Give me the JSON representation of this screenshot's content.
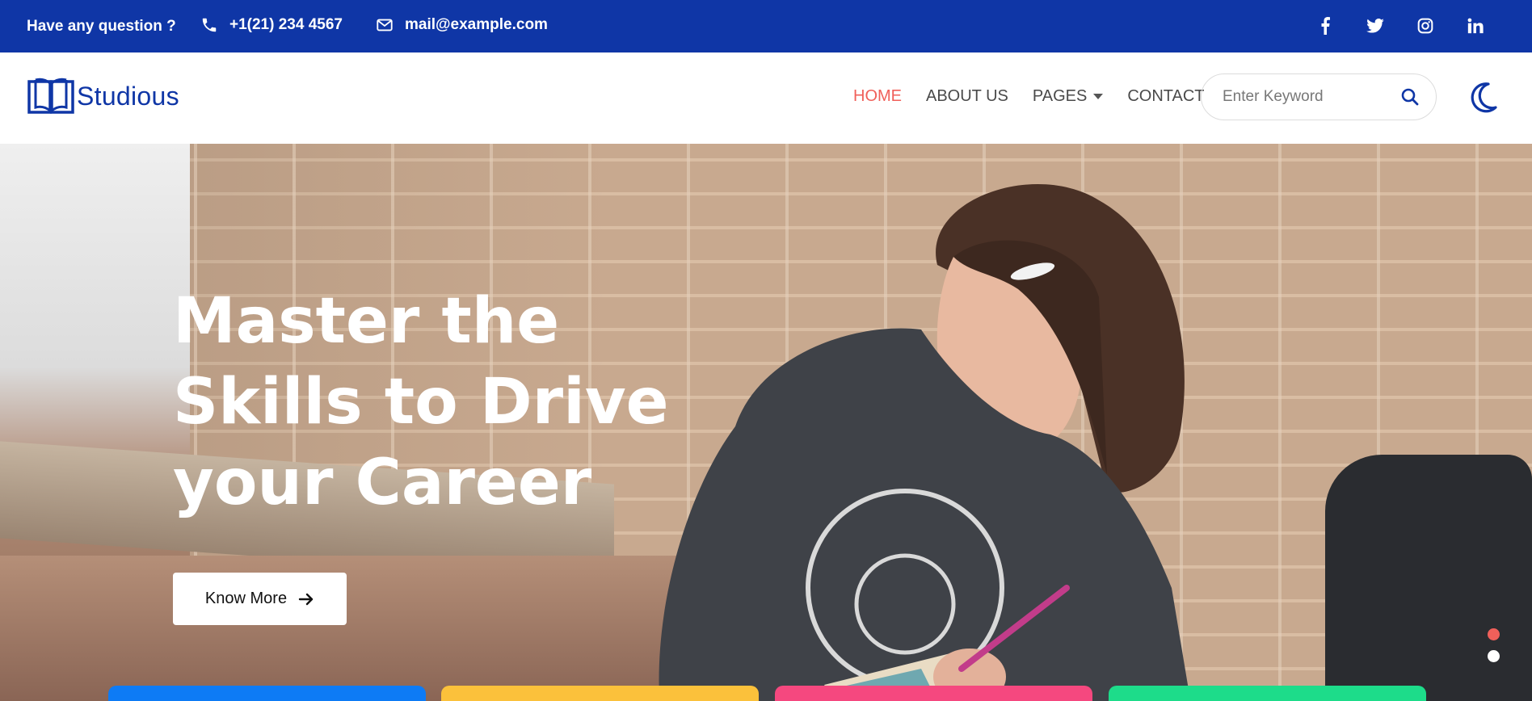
{
  "topbar": {
    "question": "Have any question ?",
    "phone": "+1(21) 234 4567",
    "email": "mail@example.com",
    "socials": [
      {
        "name": "facebook-icon",
        "glyph": "f"
      },
      {
        "name": "twitter-icon",
        "glyph": "t"
      },
      {
        "name": "instagram-icon",
        "glyph": "ig"
      },
      {
        "name": "linkedin-icon",
        "glyph": "in"
      }
    ]
  },
  "nav": {
    "brand": "Studious",
    "items": [
      {
        "label": "HOME",
        "active": true
      },
      {
        "label": "ABOUT US",
        "active": false
      },
      {
        "label": "PAGES",
        "active": false,
        "dropdown": true
      },
      {
        "label": "CONTACT",
        "active": false
      }
    ],
    "search_placeholder": "Enter Keyword"
  },
  "hero": {
    "title_lines": [
      "Master the",
      "Skills to Drive",
      "your Career"
    ],
    "cta_label": "Know More",
    "slides": 2,
    "active_slide": 1
  },
  "colors": {
    "brand": "#0f36a6",
    "active": "#f0605a",
    "card_colors": [
      "#0d7bf5",
      "#fbc13b",
      "#f5487f",
      "#1ddc8a"
    ]
  }
}
